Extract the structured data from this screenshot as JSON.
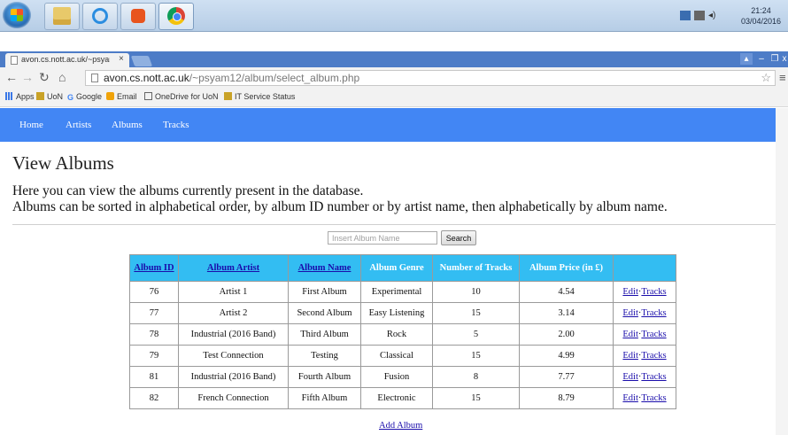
{
  "taskbar": {
    "clock_time": "21:24",
    "clock_date": "03/04/2016"
  },
  "browser": {
    "tab_title": "avon.cs.nott.ac.uk/~psyam",
    "tab_close": "×",
    "url_host": "avon.cs.nott.ac.uk",
    "url_path": "/~psyam12/album/select_album.php",
    "bookmarks": [
      "Apps",
      "UoN",
      "Google",
      "Email",
      "OneDrive for UoN",
      "IT Service Status"
    ]
  },
  "site_nav": {
    "items": [
      "Home",
      "Artists",
      "Albums",
      "Tracks"
    ]
  },
  "page": {
    "title": "View Albums",
    "intro_line1": "Here you can view the albums currently present in the database.",
    "intro_line2": "Albums can be sorted in alphabetical order, by album ID number or by artist name, then alphabetically by album name."
  },
  "search": {
    "placeholder": "Insert Album Name",
    "button_label": "Search"
  },
  "table": {
    "headers": [
      "Album ID",
      "Album Artist",
      "Album Name",
      "Album Genre",
      "Number of Tracks",
      "Album Price (in £)",
      ""
    ],
    "rows": [
      {
        "id": "76",
        "artist": "Artist 1",
        "name": "First Album",
        "genre": "Experimental",
        "tracks": "10",
        "price": "4.54"
      },
      {
        "id": "77",
        "artist": "Artist 2",
        "name": "Second Album",
        "genre": "Easy Listening",
        "tracks": "15",
        "price": "3.14"
      },
      {
        "id": "78",
        "artist": "Industrial (2016 Band)",
        "name": "Third Album",
        "genre": "Rock",
        "tracks": "5",
        "price": "2.00"
      },
      {
        "id": "79",
        "artist": "Test Connection",
        "name": "Testing",
        "genre": "Classical",
        "tracks": "15",
        "price": "4.99"
      },
      {
        "id": "81",
        "artist": "Industrial (2016 Band)",
        "name": "Fourth Album",
        "genre": "Fusion",
        "tracks": "8",
        "price": "7.77"
      },
      {
        "id": "82",
        "artist": "French Connection",
        "name": "Fifth Album",
        "genre": "Electronic",
        "tracks": "15",
        "price": "8.79"
      }
    ],
    "edit_label": "Edit",
    "tracks_label": "Tracks"
  },
  "add_album_label": "Add Album"
}
